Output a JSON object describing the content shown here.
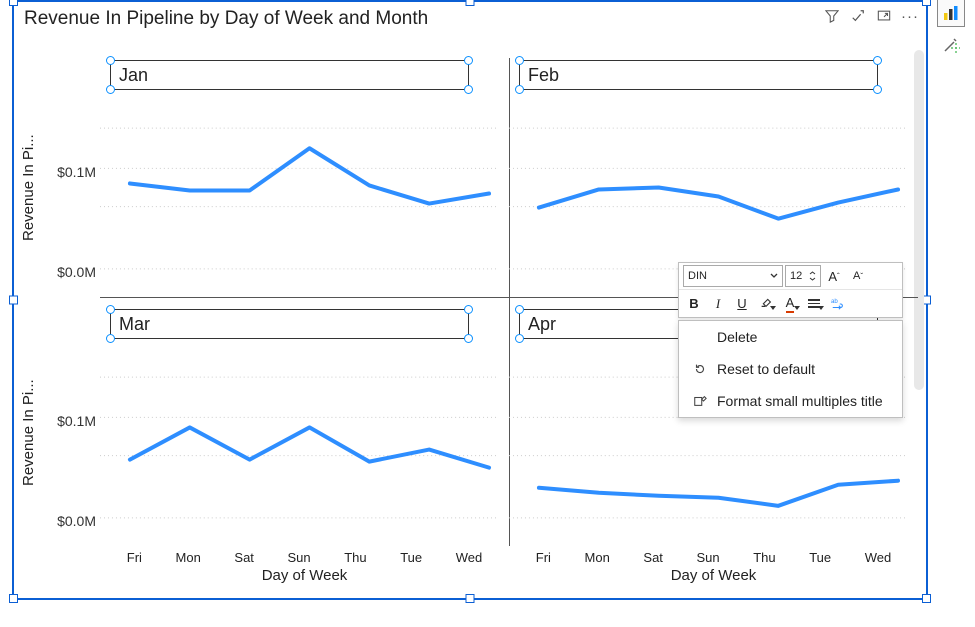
{
  "title": "Revenue In Pipeline by Day of Week and Month",
  "yaxis_title": "Revenue In Pi...",
  "xaxis_title": "Day of Week",
  "y_ticks": [
    "$0.1M",
    "$0.0M"
  ],
  "x_ticks": [
    "Fri",
    "Mon",
    "Sat",
    "Sun",
    "Thu",
    "Tue",
    "Wed"
  ],
  "panels": {
    "jan": "Jan",
    "feb": "Feb",
    "mar": "Mar",
    "apr": "Apr"
  },
  "toolbar": {
    "font": "DIN",
    "size": "12"
  },
  "context_menu": {
    "delete": "Delete",
    "reset": "Reset to default",
    "format": "Format small multiples title"
  },
  "chart_data": [
    {
      "type": "line",
      "title": "Jan",
      "xlabel": "Day of Week",
      "ylabel": "Revenue In Pipeline",
      "ylim": [
        0,
        0.15
      ],
      "yunit": "$M",
      "categories": [
        "Fri",
        "Mon",
        "Sat",
        "Sun",
        "Thu",
        "Tue",
        "Wed"
      ],
      "values": [
        0.085,
        0.078,
        0.078,
        0.12,
        0.083,
        0.065,
        0.075
      ]
    },
    {
      "type": "line",
      "title": "Feb",
      "xlabel": "Day of Week",
      "ylabel": "Revenue In Pipeline",
      "ylim": [
        0,
        0.15
      ],
      "yunit": "$M",
      "categories": [
        "Fri",
        "Mon",
        "Sat",
        "Sun",
        "Thu",
        "Tue",
        "Wed"
      ],
      "values": [
        0.061,
        0.079,
        0.081,
        0.072,
        0.05,
        0.066,
        0.079
      ]
    },
    {
      "type": "line",
      "title": "Mar",
      "xlabel": "Day of Week",
      "ylabel": "Revenue In Pipeline",
      "ylim": [
        0,
        0.15
      ],
      "yunit": "$M",
      "categories": [
        "Fri",
        "Mon",
        "Sat",
        "Sun",
        "Thu",
        "Tue",
        "Wed"
      ],
      "values": [
        0.058,
        0.09,
        0.058,
        0.09,
        0.056,
        0.068,
        0.05
      ]
    },
    {
      "type": "line",
      "title": "Apr",
      "xlabel": "Day of Week",
      "ylabel": "Revenue In Pipeline",
      "ylim": [
        0,
        0.15
      ],
      "yunit": "$M",
      "categories": [
        "Fri",
        "Mon",
        "Sat",
        "Sun",
        "Thu",
        "Tue",
        "Wed"
      ],
      "values": [
        0.03,
        0.025,
        0.022,
        0.02,
        0.012,
        0.033,
        0.037
      ]
    }
  ]
}
